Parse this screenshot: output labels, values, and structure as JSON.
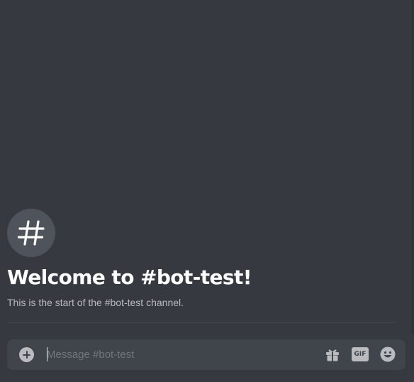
{
  "channel": {
    "name": "bot-test",
    "welcome_title": "Welcome to #bot-test!",
    "welcome_subtitle": "This is the start of the #bot-test channel."
  },
  "composer": {
    "placeholder": "Message #bot-test",
    "value": "",
    "gif_label": "GIF",
    "icons": [
      "plus-circle-icon",
      "gift-icon",
      "gif-icon",
      "emoji-icon"
    ]
  },
  "colors": {
    "background": "#36393f",
    "composer_background": "#40444b",
    "avatar_background": "#4f545c",
    "title_text": "#ffffff",
    "muted_text": "#b9bbbe",
    "placeholder_text": "#72767d"
  }
}
